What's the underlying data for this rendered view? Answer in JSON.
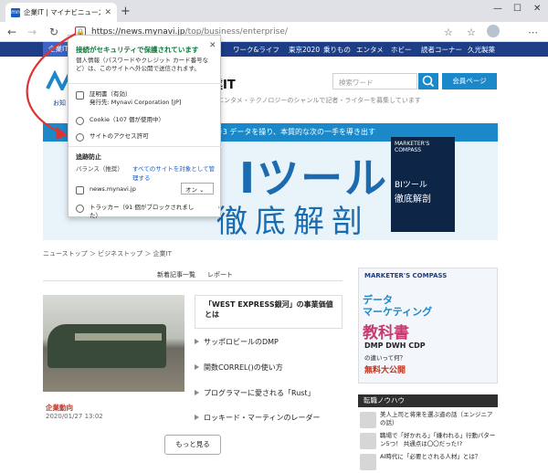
{
  "browser": {
    "tab_title": "企業IT | マイナビニュース",
    "tab_favicon": "mn",
    "new_tab": "+",
    "url_host": "https://news.mynavi.jp",
    "url_path": "/top/business/enterprise/"
  },
  "site_nav": {
    "items": [
      "企業IT",
      "ワーク&ライフ",
      "東京2020",
      "乗りもの",
      "エンタメ",
      "ホビー",
      "読者コーナー",
      "久光製薬"
    ]
  },
  "header": {
    "brand": "業IT",
    "tagline": "・エンタメ・テクノロジーのシャンルで記者・ライターを募集しています",
    "notice": "お知",
    "search_placeholder": "検索ワード",
    "member_button": "会員ページ"
  },
  "banner": {
    "strip_text": "#3 データを操り、本質的な次の一手を導き出す",
    "big_text": "Iツール",
    "big_text2": "徹底解剖",
    "book_brand": "MARKETER'S COMPASS",
    "book_title": "BIツール",
    "book_subtitle": "徹底解剖"
  },
  "breadcrumb": "ニューストップ ＞ ビジネストップ ＞ 企業IT",
  "content_tabs": [
    "新着記事一覧",
    "レポート"
  ],
  "feature": {
    "tag": "企業動向",
    "date": "2020/01/27 13:02",
    "headline": "「WEST EXPRESS銀河」の事業価値とは"
  },
  "articles": [
    "サッポロビールのDMP",
    "関数CORREL()の使い方",
    "プログラマーに愛される「Rust」",
    "ロッキード・マーティンのレーダー"
  ],
  "more_button": "もっと見る",
  "ad": {
    "brand": "MARKETER'S COMPASS",
    "line1": "データ",
    "line2": "マーケティング",
    "line3": "教科書",
    "line4": "DMP DWH CDP",
    "line5": "の違いって何？",
    "line6": "無料大公開"
  },
  "side": {
    "heading": "転職ノウハウ",
    "items": [
      "美人上司と将来を選ぶ道の話（エンジニアの話）",
      "職場で「好かれる」「嫌われる」行動パターン5つ！ 共通点は〇〇だった!?",
      "AI時代に「必要とされる人材」とは？"
    ]
  },
  "popup": {
    "title": "接続がセキュリティで保護されています",
    "description": "個人情報（パスワードやクレジット カード番号など）は、このサイトへ外公開で送信されます。",
    "cert_label": "証明書（有効）",
    "cert_issuer": "発行先: Mynavi Corporation [JP]",
    "cookie_label": "Cookie（107 個が使用中）",
    "site_permissions": "サイトのアクセス許可",
    "tracking_title": "追跡防止",
    "tracking_level": "バランス（推奨）",
    "manage_link": "すべてのサイトを対象として管理する",
    "site_name": "news.mynavi.jp",
    "toggle_value": "オン",
    "trackers": "トラッカー（91 個がブロックされました）"
  },
  "colors": {
    "nav_bg": "#1d3d86",
    "accent": "#1a88c9",
    "secure_green": "#0a7a3a",
    "annotation_red": "#d33"
  }
}
